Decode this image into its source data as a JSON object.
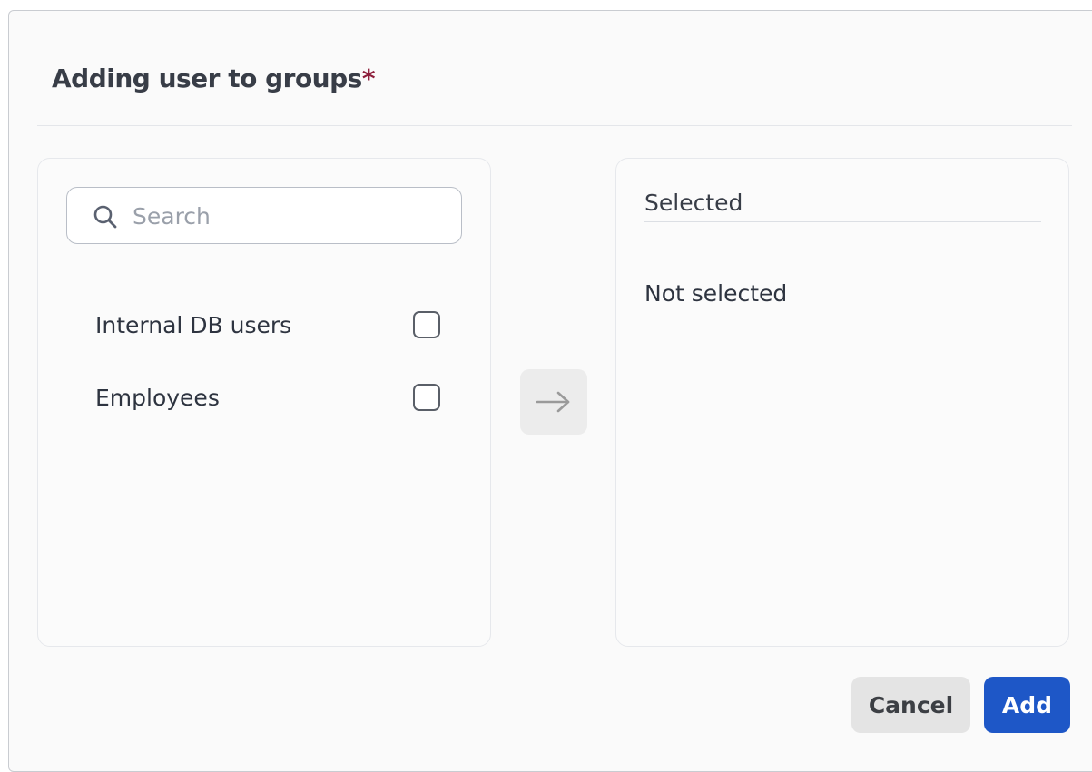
{
  "dialog": {
    "title": "Adding user to groups",
    "required_mark": "*"
  },
  "search": {
    "placeholder": "Search",
    "value": ""
  },
  "groups": [
    {
      "label": "Internal DB users",
      "checked": false
    },
    {
      "label": "Employees",
      "checked": false
    }
  ],
  "transfer": {
    "icon": "arrow-right-icon"
  },
  "selected_panel": {
    "header": "Selected",
    "empty_text": "Not selected"
  },
  "buttons": {
    "cancel": "Cancel",
    "add": "Add"
  },
  "colors": {
    "accent": "#1e57c7",
    "required": "#8c1d3a",
    "cancel_bg": "#e4e4e4"
  }
}
